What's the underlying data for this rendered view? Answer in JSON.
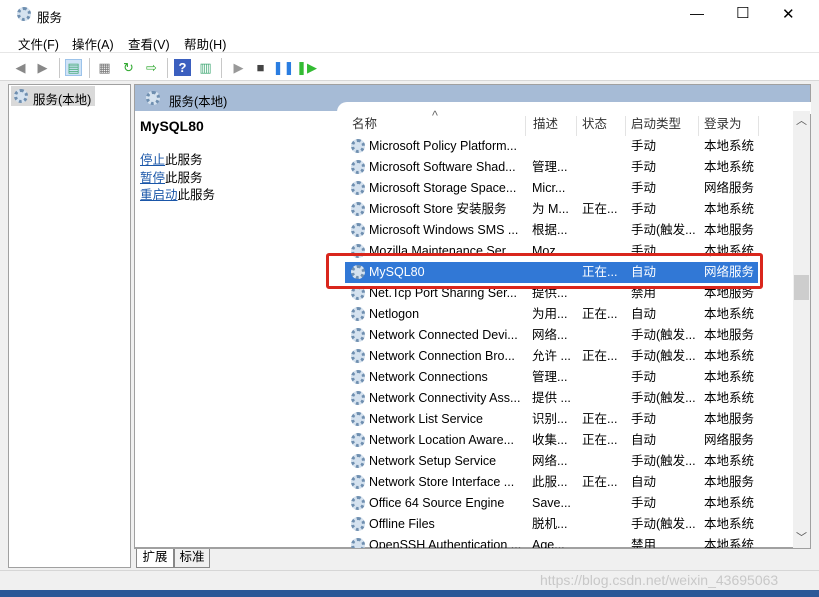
{
  "window": {
    "title": "服务",
    "minimize": "—",
    "maximize": "☐",
    "close": "✕"
  },
  "menu": [
    "文件(F)",
    "操作(A)",
    "查看(V)",
    "帮助(H)"
  ],
  "tree": {
    "item": "服务(本地)"
  },
  "panel": {
    "header": "服务(本地)"
  },
  "detail": {
    "service_name": "MySQL80",
    "actions": [
      {
        "link": "停止",
        "rest": "此服务"
      },
      {
        "link": "暂停",
        "rest": "此服务"
      },
      {
        "link": "重启动",
        "rest": "此服务"
      }
    ]
  },
  "columns": [
    "名称",
    "描述",
    "状态",
    "启动类型",
    "登录为"
  ],
  "rows": [
    [
      "Microsoft Policy Platform...",
      "",
      "",
      "手动",
      "本地系统"
    ],
    [
      "Microsoft Software Shad...",
      "管理...",
      "",
      "手动",
      "本地系统"
    ],
    [
      "Microsoft Storage Space...",
      "Micr...",
      "",
      "手动",
      "网络服务"
    ],
    [
      "Microsoft Store 安装服务",
      "为 M...",
      "正在...",
      "手动",
      "本地系统"
    ],
    [
      "Microsoft Windows SMS ...",
      "根据...",
      "",
      "手动(触发...",
      "本地服务"
    ],
    [
      "Mozilla Maintenance Ser...",
      "Moz...",
      "",
      "手动",
      "本地系统"
    ],
    [
      "MySQL80",
      "",
      "正在...",
      "自动",
      "网络服务"
    ],
    [
      "Net.Tcp Port Sharing Ser...",
      "提供...",
      "",
      "禁用",
      "本地服务"
    ],
    [
      "Netlogon",
      "为用...",
      "正在...",
      "自动",
      "本地系统"
    ],
    [
      "Network Connected Devi...",
      "网络...",
      "",
      "手动(触发...",
      "本地服务"
    ],
    [
      "Network Connection Bro...",
      "允许 ...",
      "正在...",
      "手动(触发...",
      "本地系统"
    ],
    [
      "Network Connections",
      "管理...",
      "",
      "手动",
      "本地系统"
    ],
    [
      "Network Connectivity Ass...",
      "提供 ...",
      "",
      "手动(触发...",
      "本地系统"
    ],
    [
      "Network List Service",
      "识别...",
      "正在...",
      "手动",
      "本地服务"
    ],
    [
      "Network Location Aware...",
      "收集...",
      "正在...",
      "自动",
      "网络服务"
    ],
    [
      "Network Setup Service",
      "网络...",
      "",
      "手动(触发...",
      "本地系统"
    ],
    [
      "Network Store Interface ...",
      "此服...",
      "正在...",
      "自动",
      "本地服务"
    ],
    [
      "Office 64 Source Engine",
      "Save...",
      "",
      "手动",
      "本地系统"
    ],
    [
      "Offline Files",
      "脱机...",
      "",
      "手动(触发...",
      "本地系统"
    ],
    [
      "OpenSSH Authentication ...",
      "Age...",
      "",
      "禁用",
      "本地系统"
    ]
  ],
  "selected_row": "MySQL80",
  "tabs": [
    "扩展",
    "标准"
  ],
  "active_tab": "扩展",
  "watermark": "https://blog.csdn.net/weixin_43695063",
  "colors": {
    "selection": "#3178d6",
    "highlight_box": "#d9261c",
    "link": "#1a56a8"
  }
}
